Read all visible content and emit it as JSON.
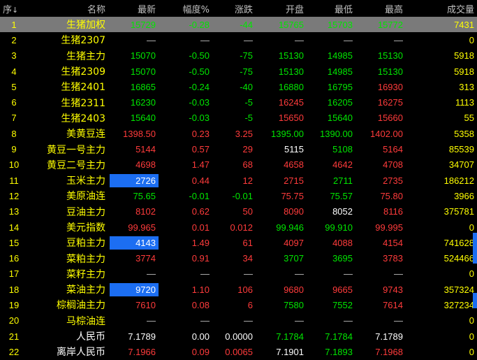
{
  "header": {
    "seq": "序",
    "seq_arrow": "↓",
    "columns": [
      "名称",
      "最新",
      "幅度%",
      "涨跌",
      "开盘",
      "最低",
      "最高",
      "成交量"
    ]
  },
  "rows": [
    {
      "cells": [
        "1",
        "生猪加权",
        "15729",
        "-0.28",
        "-44",
        "15765",
        "15703",
        "15772",
        "7431"
      ],
      "colors": [
        "y",
        "y",
        "g",
        "g",
        "g",
        "g",
        "g",
        "g",
        "y"
      ],
      "selected": true
    },
    {
      "cells": [
        "2",
        "生猪2307",
        "—",
        "—",
        "—",
        "—",
        "—",
        "—",
        "0"
      ],
      "colors": [
        "y",
        "y",
        "d",
        "d",
        "d",
        "d",
        "d",
        "d",
        "y"
      ]
    },
    {
      "cells": [
        "3",
        "生猪主力",
        "15070",
        "-0.50",
        "-75",
        "15130",
        "14985",
        "15130",
        "5918"
      ],
      "colors": [
        "y",
        "y",
        "g",
        "g",
        "g",
        "g",
        "g",
        "g",
        "y"
      ]
    },
    {
      "cells": [
        "4",
        "生猪2309",
        "15070",
        "-0.50",
        "-75",
        "15130",
        "14985",
        "15130",
        "5918"
      ],
      "colors": [
        "y",
        "y",
        "g",
        "g",
        "g",
        "g",
        "g",
        "g",
        "y"
      ]
    },
    {
      "cells": [
        "5",
        "生猪2401",
        "16865",
        "-0.24",
        "-40",
        "16880",
        "16795",
        "16930",
        "313"
      ],
      "colors": [
        "y",
        "y",
        "g",
        "g",
        "g",
        "g",
        "g",
        "r",
        "y"
      ]
    },
    {
      "cells": [
        "6",
        "生猪2311",
        "16230",
        "-0.03",
        "-5",
        "16245",
        "16205",
        "16275",
        "1113"
      ],
      "colors": [
        "y",
        "y",
        "g",
        "g",
        "g",
        "r",
        "g",
        "r",
        "y"
      ]
    },
    {
      "cells": [
        "7",
        "生猪2403",
        "15640",
        "-0.03",
        "-5",
        "15650",
        "15640",
        "15660",
        "55"
      ],
      "colors": [
        "y",
        "y",
        "g",
        "g",
        "g",
        "r",
        "g",
        "r",
        "y"
      ]
    },
    {
      "cells": [
        "8",
        "美黄豆连",
        "1398.50",
        "0.23",
        "3.25",
        "1395.00",
        "1390.00",
        "1402.00",
        "5358"
      ],
      "colors": [
        "y",
        "y",
        "r",
        "r",
        "r",
        "g",
        "g",
        "r",
        "y"
      ]
    },
    {
      "cells": [
        "9",
        "黄豆一号主力",
        "5144",
        "0.57",
        "29",
        "5115",
        "5108",
        "5164",
        "85539"
      ],
      "colors": [
        "y",
        "y",
        "r",
        "r",
        "r",
        "w",
        "g",
        "r",
        "y"
      ]
    },
    {
      "cells": [
        "10",
        "黄豆二号主力",
        "4698",
        "1.47",
        "68",
        "4658",
        "4642",
        "4708",
        "34707"
      ],
      "colors": [
        "y",
        "y",
        "r",
        "r",
        "r",
        "r",
        "r",
        "r",
        "y"
      ]
    },
    {
      "cells": [
        "11",
        "玉米主力",
        "2726",
        "0.44",
        "12",
        "2715",
        "2711",
        "2735",
        "186212"
      ],
      "colors": [
        "y",
        "y",
        "h",
        "r",
        "r",
        "r",
        "g",
        "r",
        "y"
      ]
    },
    {
      "cells": [
        "12",
        "美原油连",
        "75.65",
        "-0.01",
        "-0.01",
        "75.75",
        "75.57",
        "75.80",
        "3966"
      ],
      "colors": [
        "y",
        "y",
        "g",
        "g",
        "g",
        "r",
        "g",
        "r",
        "y"
      ]
    },
    {
      "cells": [
        "13",
        "豆油主力",
        "8102",
        "0.62",
        "50",
        "8090",
        "8052",
        "8116",
        "375781"
      ],
      "colors": [
        "y",
        "y",
        "r",
        "r",
        "r",
        "r",
        "w",
        "r",
        "y"
      ]
    },
    {
      "cells": [
        "14",
        "美元指数",
        "99.965",
        "0.01",
        "0.012",
        "99.946",
        "99.910",
        "99.995",
        "0"
      ],
      "colors": [
        "y",
        "y",
        "r",
        "r",
        "r",
        "g",
        "g",
        "r",
        "y"
      ]
    },
    {
      "cells": [
        "15",
        "豆粕主力",
        "4143",
        "1.49",
        "61",
        "4097",
        "4088",
        "4154",
        "741628"
      ],
      "colors": [
        "y",
        "y",
        "h",
        "r",
        "r",
        "r",
        "r",
        "r",
        "y"
      ]
    },
    {
      "cells": [
        "16",
        "菜粕主力",
        "3774",
        "0.91",
        "34",
        "3707",
        "3695",
        "3783",
        "524466"
      ],
      "colors": [
        "y",
        "y",
        "r",
        "r",
        "r",
        "g",
        "g",
        "r",
        "y"
      ]
    },
    {
      "cells": [
        "17",
        "菜籽主力",
        "—",
        "—",
        "—",
        "—",
        "—",
        "—",
        "0"
      ],
      "colors": [
        "y",
        "y",
        "d",
        "d",
        "d",
        "d",
        "d",
        "d",
        "y"
      ]
    },
    {
      "cells": [
        "18",
        "菜油主力",
        "9720",
        "1.10",
        "106",
        "9680",
        "9665",
        "9743",
        "357324"
      ],
      "colors": [
        "y",
        "y",
        "h",
        "r",
        "r",
        "r",
        "r",
        "r",
        "y"
      ]
    },
    {
      "cells": [
        "19",
        "棕榈油主力",
        "7610",
        "0.08",
        "6",
        "7580",
        "7552",
        "7614",
        "327234"
      ],
      "colors": [
        "y",
        "y",
        "r",
        "r",
        "r",
        "g",
        "g",
        "r",
        "y"
      ]
    },
    {
      "cells": [
        "20",
        "马棕油连",
        "—",
        "—",
        "—",
        "—",
        "—",
        "—",
        "0"
      ],
      "colors": [
        "y",
        "y",
        "d",
        "d",
        "d",
        "d",
        "d",
        "d",
        "y"
      ]
    },
    {
      "cells": [
        "21",
        "人民币",
        "7.1789",
        "0.00",
        "0.0000",
        "7.1784",
        "7.1784",
        "7.1789",
        "0"
      ],
      "colors": [
        "y",
        "w",
        "w",
        "w",
        "w",
        "g",
        "g",
        "w",
        "y"
      ]
    },
    {
      "cells": [
        "22",
        "离岸人民币",
        "7.1966",
        "0.09",
        "0.0065",
        "7.1901",
        "7.1893",
        "7.1968",
        "0"
      ],
      "colors": [
        "y",
        "w",
        "r",
        "r",
        "r",
        "w",
        "g",
        "r",
        "y"
      ]
    }
  ],
  "colors": {
    "red": "#ff3b3b",
    "green": "#00e600",
    "yellow": "#ffff00",
    "highlight": "#1c6ef2",
    "selected_row": "#7a7a7a"
  }
}
